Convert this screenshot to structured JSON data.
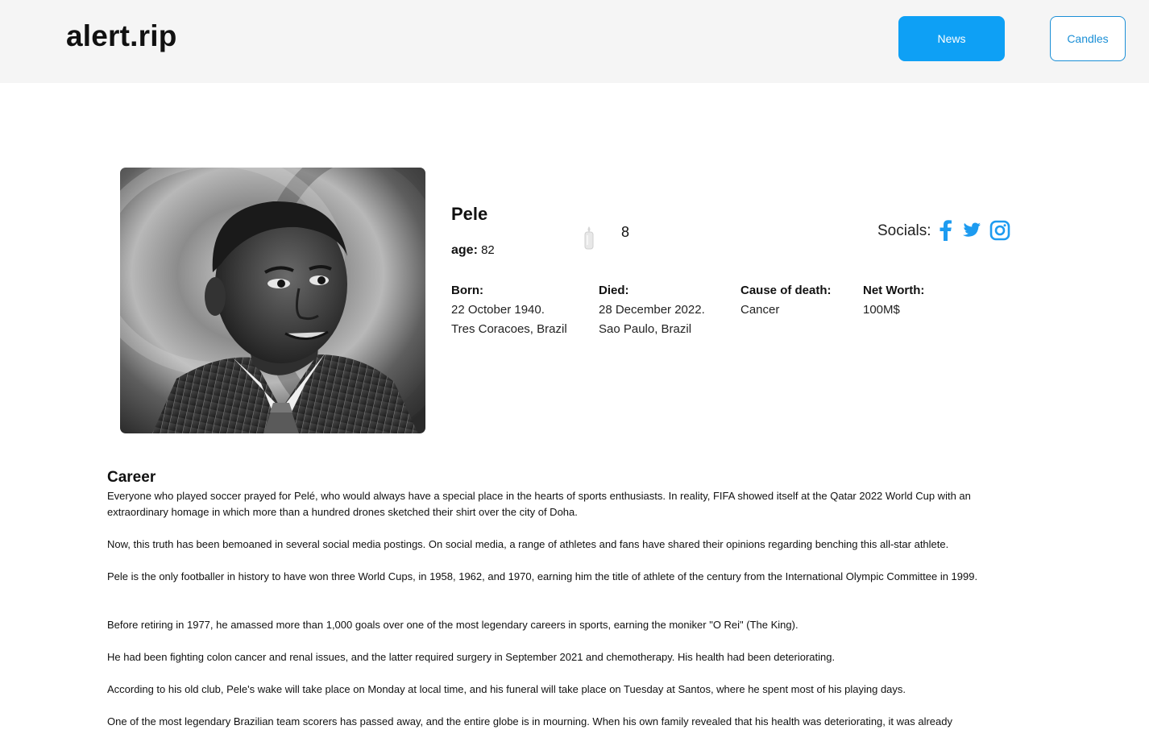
{
  "header": {
    "logo": "alert.rip",
    "nav": {
      "news_label": "News",
      "candles_label": "Candles"
    }
  },
  "profile": {
    "photo_icon": "portrait-photo",
    "name": "Pele",
    "age_label": "age:",
    "age_value": "82",
    "candle_icon": "candle-icon",
    "candle_count": "8",
    "socials_label": "Socials:",
    "socials": [
      "facebook-icon",
      "twitter-icon",
      "instagram-icon"
    ],
    "facts": {
      "born": {
        "label": "Born:",
        "date": "22 October 1940.",
        "place": "Tres Coracoes, Brazil"
      },
      "died": {
        "label": "Died:",
        "date": "28 December 2022.",
        "place": "Sao Paulo, Brazil"
      },
      "cause": {
        "label": "Cause of death:",
        "value": "Cancer"
      },
      "net_worth": {
        "label": "Net Worth:",
        "value": "100M$"
      }
    }
  },
  "career": {
    "title": "Career",
    "paragraphs": [
      "Everyone who played soccer prayed for Pelé, who would always have a special place in the hearts of sports enthusiasts. In reality, FIFA showed itself at the Qatar 2022 World Cup with an extraordinary homage in which more than a hundred drones sketched their shirt over the city of Doha.",
      "Now, this truth has been bemoaned in several social media postings. On social media, a range of athletes and fans have shared their opinions regarding benching this all-star athlete.",
      "Pele is the only footballer in history to have won three World Cups, in 1958, 1962, and 1970, earning him the title of athlete of the century from the International Olympic Committee in 1999.",
      "Before retiring in 1977, he amassed more than 1,000 goals over one of the most legendary careers in sports, earning the moniker \"O Rei\" (The King).",
      "He had been fighting colon cancer and renal issues, and the latter required surgery in September 2021 and chemotherapy. His health had been deteriorating.",
      "According to his old club, Pele's wake will take place on Monday at local time, and his funeral will take place on Tuesday at Santos, where he spent most of his playing days.",
      "One of the most legendary Brazilian team scorers has passed away, and the entire globe is in mourning. When his own family revealed that his health was deteriorating, it was already"
    ]
  },
  "colors": {
    "header_bg": "#f5f5f5",
    "accent": "#0ea0f5",
    "social_blue": "#1d9bf0"
  }
}
